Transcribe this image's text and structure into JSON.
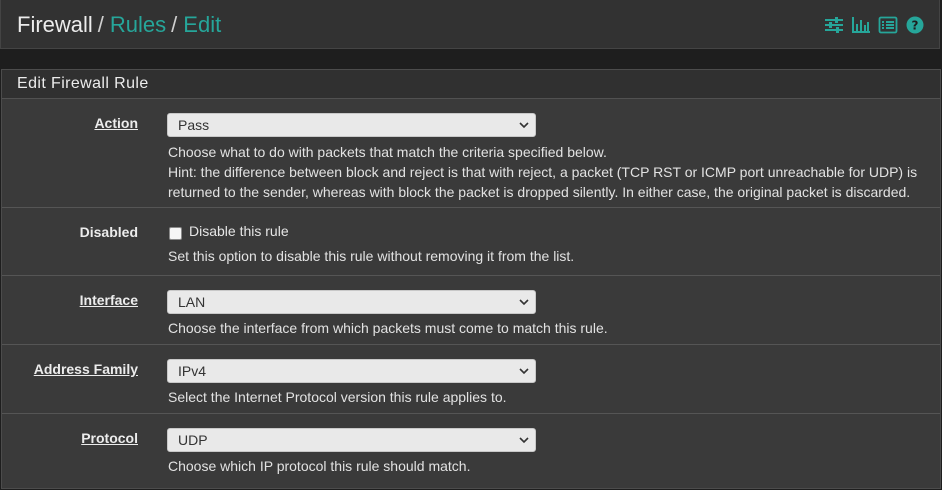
{
  "breadcrumb": {
    "root": "Firewall",
    "sep": "/",
    "rules": "Rules",
    "edit": "Edit"
  },
  "toolbar_icons": [
    "sliders-icon",
    "bar-chart-icon",
    "list-icon",
    "help-circle-icon"
  ],
  "accent_color": "#26a69a",
  "panel_title": "Edit Firewall Rule",
  "action": {
    "label": "Action",
    "value": "Pass",
    "help1": "Choose what to do with packets that match the criteria specified below.",
    "help2": "Hint: the difference between block and reject is that with reject, a packet (TCP RST or ICMP port unreachable for UDP) is returned to the sender, whereas with block the packet is dropped silently. In either case, the original packet is discarded."
  },
  "disabled": {
    "label": "Disabled",
    "checkbox_label": "Disable this rule",
    "checked": false,
    "help": "Set this option to disable this rule without removing it from the list."
  },
  "interface": {
    "label": "Interface",
    "value": "LAN",
    "help": "Choose the interface from which packets must come to match this rule."
  },
  "address_family": {
    "label": "Address Family",
    "value": "IPv4",
    "help": "Select the Internet Protocol version this rule applies to."
  },
  "protocol": {
    "label": "Protocol",
    "value": "UDP",
    "help": "Choose which IP protocol this rule should match."
  }
}
